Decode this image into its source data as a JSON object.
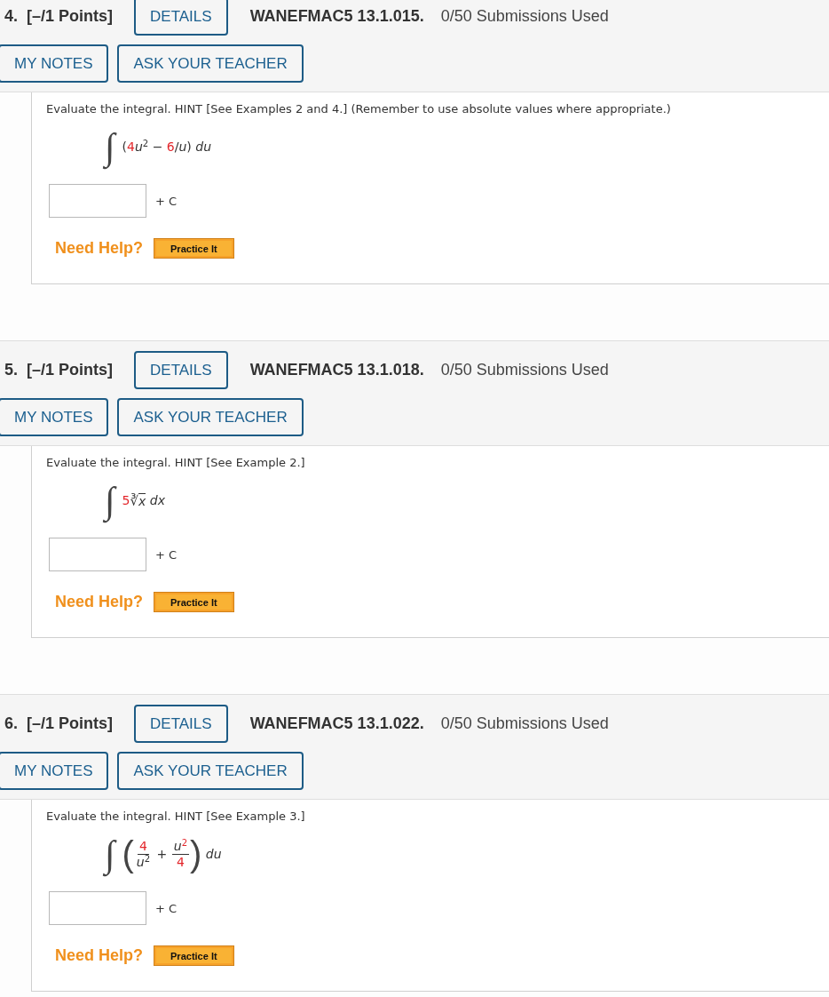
{
  "questions": [
    {
      "number": "4.",
      "points": "[–/1 Points]",
      "details": "DETAILS",
      "code": "WANEFMAC5 13.1.015.",
      "submissions": "0/50 Submissions Used",
      "actions": [
        "MY NOTES",
        "ASK YOUR TEACHER"
      ],
      "prompt": "Evaluate the integral. HINT [See Examples 2 and 4.] (Remember to use absolute values where appropriate.)",
      "integral": {
        "sign": "∫",
        "parts": [
          {
            "kind": "text",
            "text": "(",
            "color": "#333333"
          },
          {
            "kind": "text",
            "text": "4",
            "color": "#e3262b"
          },
          {
            "kind": "text",
            "text": "*u*$^{2}$ − ",
            "color": "#333333"
          },
          {
            "kind": "text",
            "text": "6",
            "color": "#e3262b"
          },
          {
            "kind": "text",
            "text": "/*u*) *du*",
            "color": "#333333"
          }
        ]
      },
      "answer_suffix": "+ C",
      "help_label": "Need Help?",
      "help_button": "Practice It"
    },
    {
      "number": "5.",
      "points": "[–/1 Points]",
      "details": "DETAILS",
      "code": "WANEFMAC5 13.1.018.",
      "submissions": "0/50 Submissions Used",
      "actions": [
        "MY NOTES",
        "ASK YOUR TEACHER"
      ],
      "prompt": "Evaluate the integral. HINT [See Example 2.]",
      "integral": {
        "sign": "∫",
        "parts": [
          {
            "kind": "text",
            "text": "5",
            "color": "#e3262b"
          },
          {
            "kind": "root",
            "sign": "∛",
            "radicand": [
              {
                "kind": "text",
                "text": "*x*",
                "color": "#333333"
              }
            ]
          },
          {
            "kind": "text",
            "text": " *dx*",
            "color": "#333333"
          }
        ]
      },
      "answer_suffix": "+ C",
      "help_label": "Need Help?",
      "help_button": "Practice It"
    },
    {
      "number": "6.",
      "points": "[–/1 Points]",
      "details": "DETAILS",
      "code": "WANEFMAC5 13.1.022.",
      "submissions": "0/50 Submissions Used",
      "actions": [
        "MY NOTES",
        "ASK YOUR TEACHER"
      ],
      "prompt": "Evaluate the integral. HINT [See Example 3.]",
      "integral": {
        "sign": "∫",
        "parts": [
          {
            "kind": "group",
            "open": "(",
            "close": ")",
            "children": [
              {
                "kind": "frac",
                "num": [
                  {
                    "kind": "text",
                    "text": "4",
                    "color": "#e3262b"
                  }
                ],
                "den": [
                  {
                    "kind": "text",
                    "text": "*u*$^{2}$",
                    "color": "#333333"
                  }
                ]
              },
              {
                "kind": "text",
                "text": " + ",
                "color": "#333333"
              },
              {
                "kind": "frac",
                "num": [
                  {
                    "kind": "text",
                    "text": "*u*",
                    "color": "#333333"
                  },
                  {
                    "kind": "text",
                    "text": "$^{2}$",
                    "color": "#e3262b"
                  }
                ],
                "den": [
                  {
                    "kind": "text",
                    "text": "4",
                    "color": "#e3262b"
                  }
                ]
              }
            ]
          },
          {
            "kind": "text",
            "text": " *du*",
            "color": "#333333"
          }
        ]
      },
      "answer_suffix": "+ C",
      "help_label": "Need Help?",
      "help_button": "Practice It"
    }
  ]
}
